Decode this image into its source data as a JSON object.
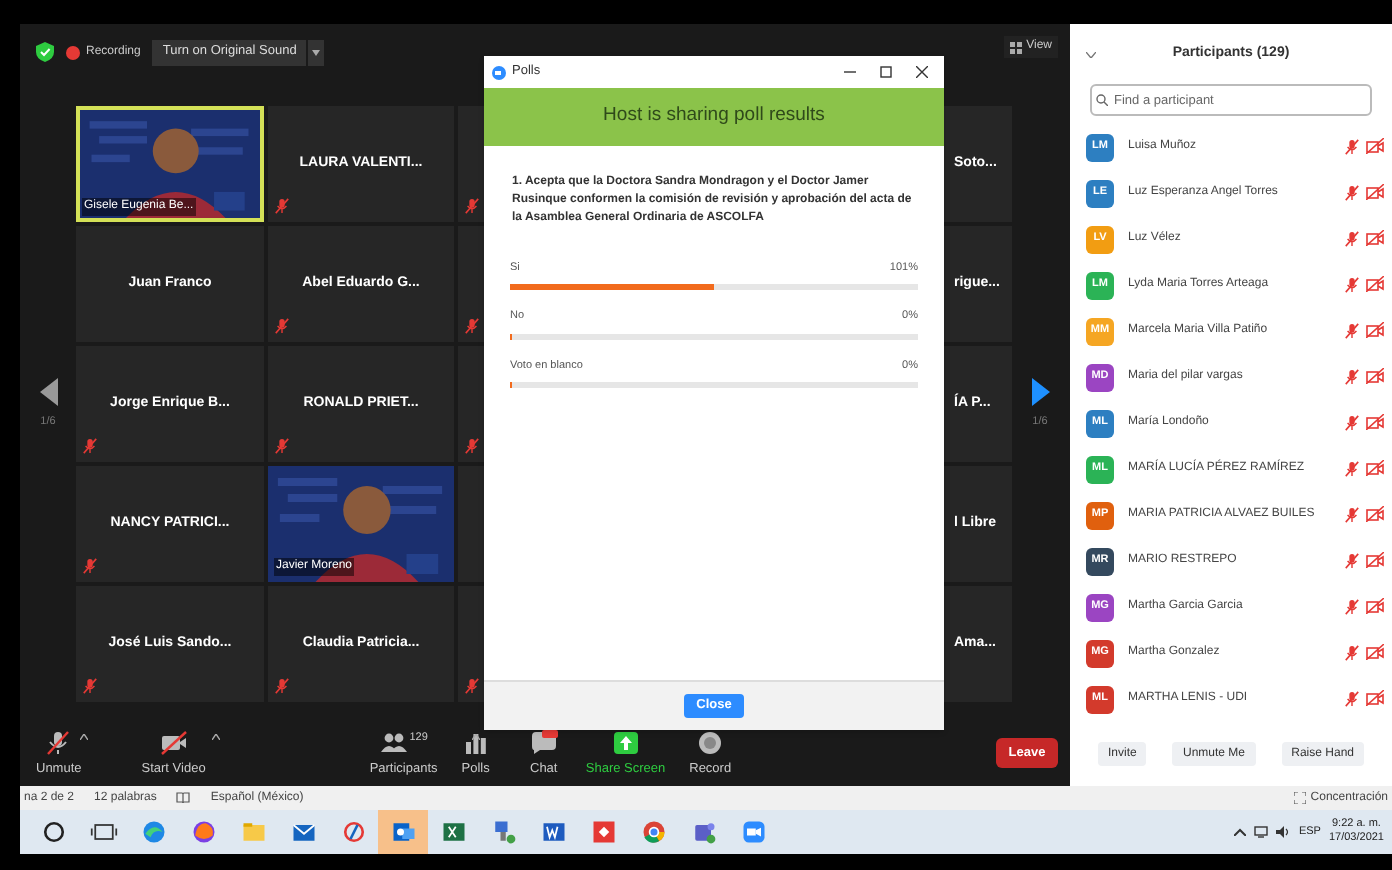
{
  "top_bar": {
    "recording": "Recording",
    "original_sound_button": "Turn on Original Sound",
    "view_button": "View"
  },
  "video_grid": {
    "page_left": "1/6",
    "page_right": "1/6",
    "rows": [
      [
        {
          "kind": "video",
          "name": "Gisele Eugenia Be...",
          "speaking": true,
          "muted": false
        },
        {
          "kind": "name",
          "name": "LAURA VALENTI...",
          "muted": true
        },
        {
          "kind": "hidden",
          "muted": true
        },
        {
          "kind": "spacer"
        },
        {
          "kind": "fragment",
          "name": "Soto..."
        }
      ],
      [
        {
          "kind": "name",
          "name": "Juan Franco",
          "muted": false
        },
        {
          "kind": "name",
          "name": "Abel Eduardo G...",
          "muted": true
        },
        {
          "kind": "hidden",
          "muted": true
        },
        {
          "kind": "spacer"
        },
        {
          "kind": "fragment",
          "name": "rigue..."
        }
      ],
      [
        {
          "kind": "name",
          "name": "Jorge Enrique B...",
          "muted": true
        },
        {
          "kind": "name",
          "name": "RONALD PRIET...",
          "muted": true
        },
        {
          "kind": "hidden",
          "muted": true
        },
        {
          "kind": "spacer"
        },
        {
          "kind": "fragment",
          "name": "ÍA P..."
        }
      ],
      [
        {
          "kind": "name",
          "name": "NANCY PATRICI...",
          "muted": true
        },
        {
          "kind": "video",
          "name": "Javier Moreno",
          "speaking": false,
          "muted": false
        },
        {
          "kind": "hidden",
          "muted": false
        },
        {
          "kind": "spacer"
        },
        {
          "kind": "fragment",
          "name": "l Libre"
        }
      ],
      [
        {
          "kind": "name",
          "name": "José Luis Sando...",
          "muted": true
        },
        {
          "kind": "name",
          "name": "Claudia  Patricia...",
          "muted": true
        },
        {
          "kind": "hidden",
          "muted": true
        },
        {
          "kind": "spacer"
        },
        {
          "kind": "fragment",
          "name": "Ama..."
        }
      ]
    ]
  },
  "poll": {
    "title": "Polls",
    "banner": "Host is sharing poll results",
    "question": "1. Acepta que la Doctora Sandra Mondragon y el Doctor Jamer Rusinque conformen la comisión de revisión y aprobación del acta de la Asamblea General Ordinaria de ASCOLFA",
    "options": [
      {
        "label": "Si",
        "percent": "101%",
        "level": 0.5
      },
      {
        "label": "No",
        "percent": "0%",
        "level": 0
      },
      {
        "label": "Voto en blanco",
        "percent": "0%",
        "level": 0
      }
    ],
    "close_button": "Close"
  },
  "toolbar": {
    "items": [
      {
        "kind": "mic",
        "label": "Unmute"
      },
      {
        "kind": "video",
        "label": "Start Video"
      },
      {
        "kind": "participants",
        "label": "Participants",
        "count": "129"
      },
      {
        "kind": "polls",
        "label": "Polls"
      },
      {
        "kind": "chat",
        "label": "Chat"
      },
      {
        "kind": "share",
        "label": "Share Screen"
      },
      {
        "kind": "record",
        "label": "Record"
      }
    ],
    "leave_button": "Leave"
  },
  "participants": {
    "title": "Participants (129)",
    "search_placeholder": "Find a participant",
    "items": [
      {
        "initials": "LM",
        "name": "Luisa Muñoz",
        "color": "#2d7fc1"
      },
      {
        "initials": "LE",
        "name": "Luz Esperanza Angel Torres",
        "color": "#2d7fc1"
      },
      {
        "initials": "LV",
        "name": "Luz Vélez",
        "color": "#f29d12"
      },
      {
        "initials": "LM",
        "name": "Lyda Maria Torres Arteaga",
        "color": "#2bb356"
      },
      {
        "initials": "MM",
        "name": "Marcela Maria Villa Patiño",
        "color": "#f5a623"
      },
      {
        "initials": "MD",
        "name": "Maria del pilar vargas",
        "color": "#9b45c2"
      },
      {
        "initials": "ML",
        "name": "María Londoño",
        "color": "#2d7fc1"
      },
      {
        "initials": "ML",
        "name": "MARÍA LUCÍA PÉREZ RAMÍREZ",
        "color": "#2bb356"
      },
      {
        "initials": "MP",
        "name": "MARIA PATRICIA ALVAEZ BUILES",
        "color": "#e0600e"
      },
      {
        "initials": "MR",
        "name": "MARIO RESTREPO",
        "color": "#34495e"
      },
      {
        "initials": "MG",
        "name": "Martha Garcia Garcia",
        "color": "#9b45c2"
      },
      {
        "initials": "MG",
        "name": "Martha Gonzalez",
        "color": "#d33a2c"
      },
      {
        "initials": "ML",
        "name": "MARTHA LENIS - UDI",
        "color": "#d33a2c"
      }
    ],
    "buttons": [
      "Invite",
      "Unmute Me",
      "Raise Hand"
    ]
  },
  "word_status_bar": {
    "page": "na 2 de 2",
    "words": "12 palabras",
    "language": "Español (México)",
    "focus": "Concentración"
  },
  "taskbar": {
    "language": "ESP",
    "time": "9:22 a. m.",
    "date": "17/03/2021"
  }
}
